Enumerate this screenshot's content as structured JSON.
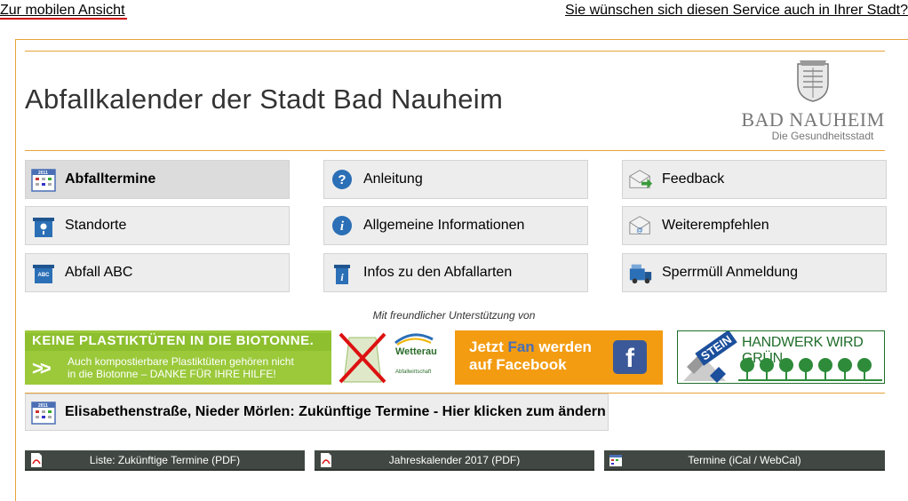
{
  "top_links": {
    "mobile": "Zur mobilen Ansicht",
    "service": "Sie wünschen sich diesen Service auch in Ihrer Stadt?"
  },
  "header": {
    "title": "Abfallkalender der Stadt Bad Nauheim",
    "logo_name": "BAD NAUHEIM",
    "logo_sub": "Die Gesundheitsstadt"
  },
  "nav": [
    {
      "label": "Abfalltermine",
      "icon": "calendar-icon",
      "active": true
    },
    {
      "label": "Anleitung",
      "icon": "question-icon"
    },
    {
      "label": "Feedback",
      "icon": "mail-arrow-icon"
    },
    {
      "label": "Standorte",
      "icon": "location-bin-icon"
    },
    {
      "label": "Allgemeine Informationen",
      "icon": "info-icon"
    },
    {
      "label": "Weiterempfehlen",
      "icon": "mail-at-icon"
    },
    {
      "label": "Abfall ABC",
      "icon": "abc-bin-icon"
    },
    {
      "label": "Infos zu den Abfallarten",
      "icon": "info-bin-icon"
    },
    {
      "label": "Sperrmüll Anmeldung",
      "icon": "truck-icon"
    }
  ],
  "support_text": "Mit freundlicher Unterstützung von",
  "banners": {
    "biotonne_head": "KEINE PLASTIKTÜTEN IN DIE BIOTONNE.",
    "biotonne_line1": "Auch kompostierbare Plastiktüten gehören nicht",
    "biotonne_line2": "in die Biotonne – DANKE FÜR IHRE HILFE!",
    "wetterau": "Wetterau",
    "wetterau_sub": "Abfallwirtschaft",
    "facebook_line1_a": "Jetzt ",
    "facebook_fan": "Fan",
    "facebook_line1_b": " werden",
    "facebook_line2": "auf Facebook",
    "facebook_logo": "f",
    "stein_logo": "STEIN",
    "handwerk": "HANDWERK WIRD GRÜN"
  },
  "address_button": "Elisabethenstraße, Nieder Mörlen: Zukünftige Termine - Hier klicken zum ändern",
  "downloads": [
    {
      "label": "Liste: Zukünftige Termine (PDF)",
      "icon": "pdf-icon"
    },
    {
      "label": "Jahreskalender 2017 (PDF)",
      "icon": "pdf-icon"
    },
    {
      "label": "Termine (iCal / WebCal)",
      "icon": "calendar-icon"
    }
  ],
  "colors": {
    "accent": "#e8a33a",
    "link_underline": "#cc0000",
    "download_bar": "#414843"
  }
}
